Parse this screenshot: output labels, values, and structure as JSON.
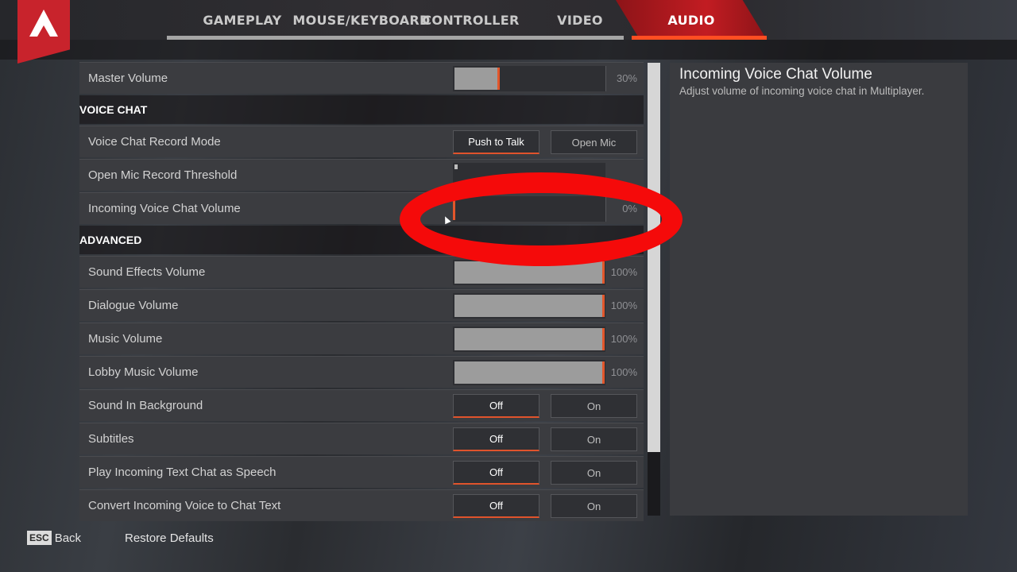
{
  "tabs": [
    {
      "label": "GAMEPLAY",
      "active": false
    },
    {
      "label": "MOUSE/KEYBOARD",
      "active": false
    },
    {
      "label": "CONTROLLER",
      "active": false
    },
    {
      "label": "VIDEO",
      "active": false
    },
    {
      "label": "AUDIO",
      "active": true
    }
  ],
  "colors": {
    "accent": "#e0532c",
    "brand_red": "#c8232c",
    "annotation": "#f50a0a"
  },
  "settings": {
    "master_volume": {
      "label": "Master Volume",
      "value_pct": 30,
      "display": "30%"
    },
    "voice_chat_header": "VOICE CHAT",
    "record_mode": {
      "label": "Voice Chat Record Mode",
      "options": [
        "Push to Talk",
        "Open Mic"
      ],
      "selected": "Push to Talk"
    },
    "threshold": {
      "label": "Open Mic Record Threshold",
      "display": ""
    },
    "incoming_voice": {
      "label": "Incoming Voice Chat Volume",
      "value_pct": 0,
      "display": "0%"
    },
    "advanced_header": "ADVANCED",
    "sliders": [
      {
        "label": "Sound Effects Volume",
        "value_pct": 100,
        "display": "100%"
      },
      {
        "label": "Dialogue Volume",
        "value_pct": 100,
        "display": "100%"
      },
      {
        "label": "Music Volume",
        "value_pct": 100,
        "display": "100%"
      },
      {
        "label": "Lobby Music Volume",
        "value_pct": 100,
        "display": "100%"
      }
    ],
    "toggles": [
      {
        "label": "Sound In Background",
        "off": "Off",
        "on": "On",
        "selected": "Off"
      },
      {
        "label": "Subtitles",
        "off": "Off",
        "on": "On",
        "selected": "Off"
      },
      {
        "label": "Play Incoming Text Chat as Speech",
        "off": "Off",
        "on": "On",
        "selected": "Off"
      },
      {
        "label": "Convert Incoming Voice to Chat Text",
        "off": "Off",
        "on": "On",
        "selected": "Off"
      }
    ]
  },
  "description": {
    "title": "Incoming Voice Chat Volume",
    "text": "Adjust volume of incoming voice chat in Multiplayer."
  },
  "footer": {
    "esc_key": "ESC",
    "back": "Back",
    "restore": "Restore Defaults"
  }
}
